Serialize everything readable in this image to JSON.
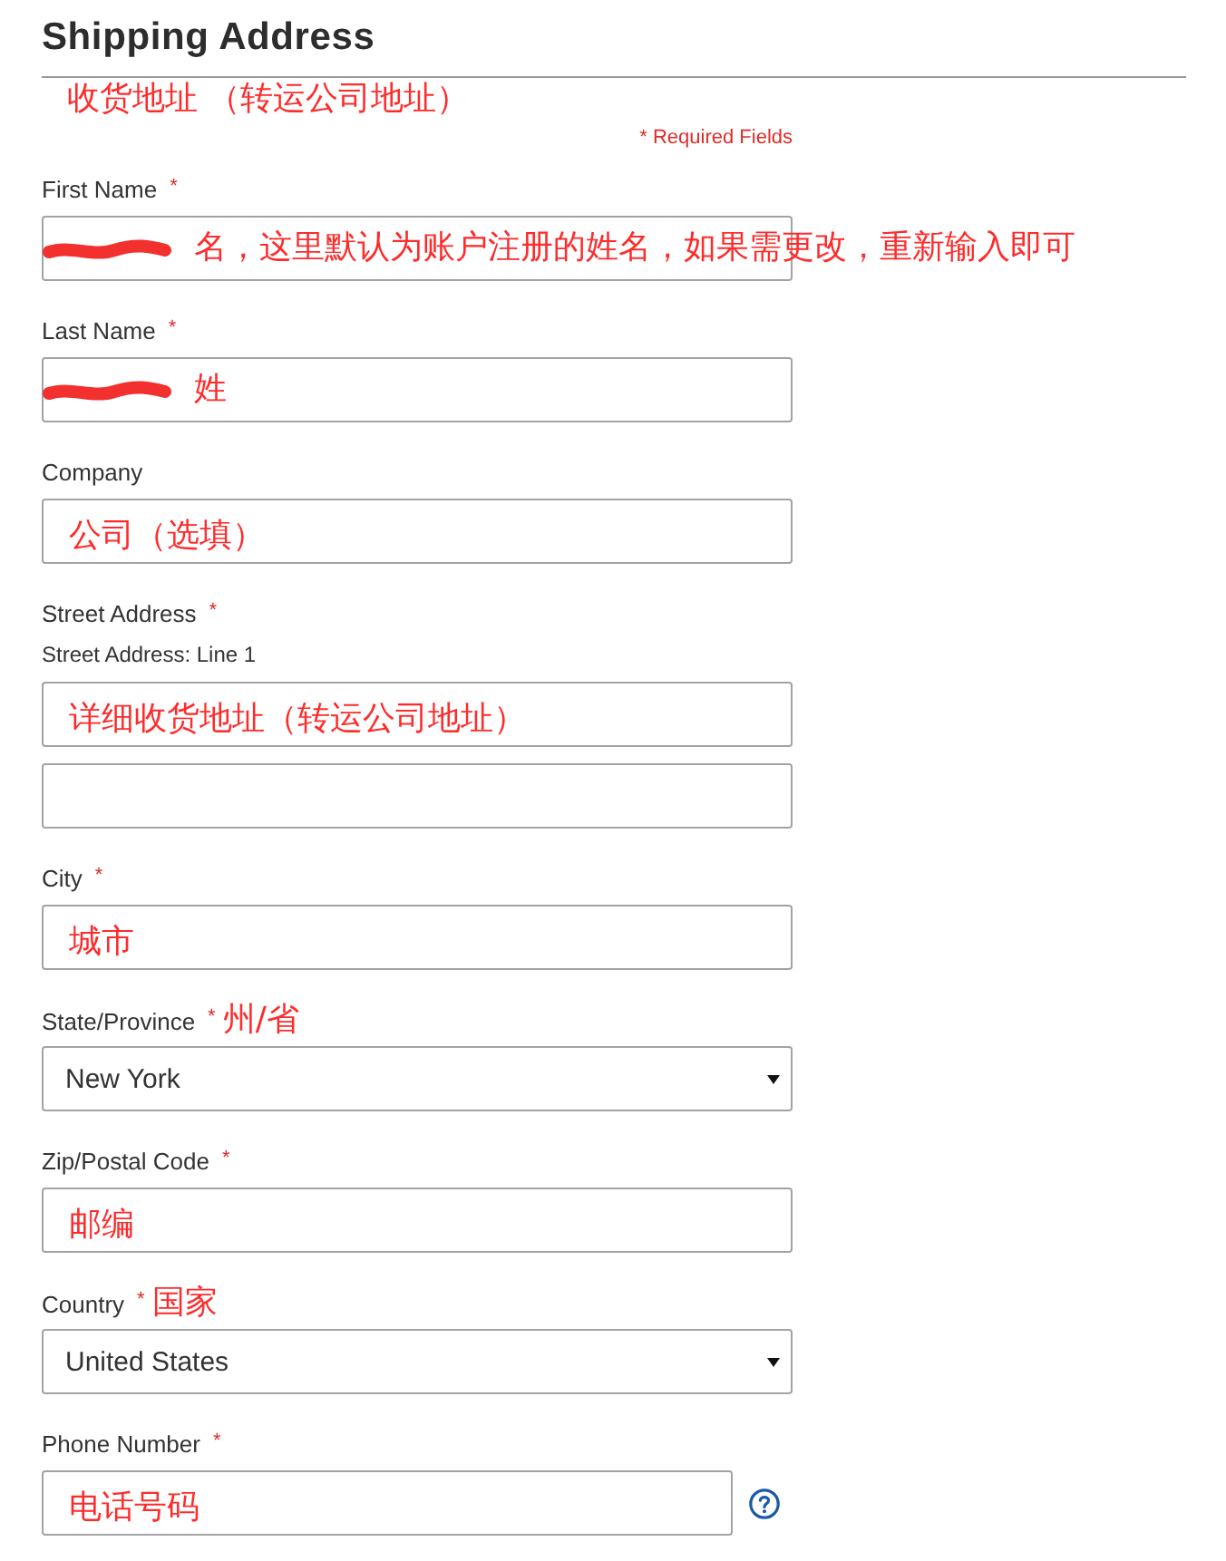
{
  "section": {
    "title": "Shipping Address",
    "annotation": "收货地址 （转运公司地址）",
    "required_note": "* Required Fields"
  },
  "fields": [
    {
      "kind": "text",
      "label": "First Name",
      "required_mark": "*",
      "inputs": [
        {
          "redacted": true,
          "annotation": "名，这里默认为账户注册的姓名，如果需更改，重新输入即可"
        }
      ]
    },
    {
      "kind": "text",
      "label": "Last Name",
      "required_mark": "*",
      "inputs": [
        {
          "redacted": true,
          "annotation": "姓"
        }
      ]
    },
    {
      "kind": "text",
      "label": "Company",
      "inputs": [
        {
          "redacted": false,
          "annotation": "公司（选填）"
        }
      ]
    },
    {
      "kind": "text",
      "label": "Street Address",
      "required_mark": "*",
      "sublabel": "Street Address: Line 1",
      "inputs": [
        {
          "redacted": false,
          "annotation": "详细收货地址（转运公司地址）"
        },
        {
          "redacted": false
        }
      ]
    },
    {
      "kind": "text",
      "label": "City",
      "required_mark": "*",
      "inputs": [
        {
          "redacted": false,
          "annotation": "城市"
        }
      ]
    },
    {
      "kind": "select",
      "label": "State/Province",
      "required_mark": "*",
      "label_annotation": "州/省",
      "inputs": [
        {
          "redacted": false,
          "value": "New York"
        }
      ]
    },
    {
      "kind": "text",
      "label": "Zip/Postal Code",
      "required_mark": "*",
      "inputs": [
        {
          "redacted": false,
          "annotation": "邮编"
        }
      ]
    },
    {
      "kind": "select",
      "label": "Country",
      "required_mark": "*",
      "label_annotation": "国家",
      "inputs": [
        {
          "redacted": false,
          "value": "United States"
        }
      ]
    },
    {
      "kind": "text",
      "label": "Phone Number",
      "required_mark": "*",
      "help_icon": true,
      "inputs": [
        {
          "redacted": false,
          "annotation": "电话号码"
        }
      ]
    }
  ]
}
